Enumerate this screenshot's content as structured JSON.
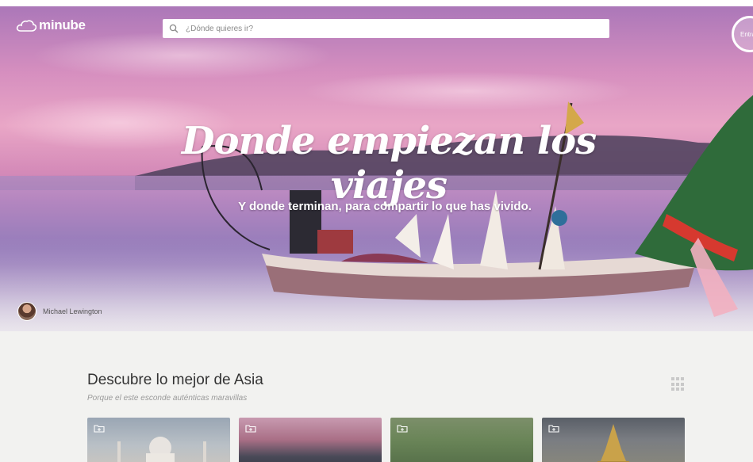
{
  "header": {
    "logo_text": "minube",
    "search_placeholder": "¿Dónde quieres ir?",
    "login_label": "Entrar"
  },
  "hero": {
    "title": "Donde empiezan los viajes",
    "subtitle": "Y donde terminan, para compartir lo que has vivido.",
    "photo_credit": "Michael Lewington"
  },
  "section": {
    "title": "Descubre lo mejor de Asia",
    "subtitle": "Porque el este esconde auténticas maravillas"
  },
  "cards": [
    {
      "icon": "folder-add-icon"
    },
    {
      "icon": "folder-add-icon"
    },
    {
      "icon": "folder-add-icon"
    },
    {
      "icon": "folder-add-icon"
    }
  ],
  "colors": {
    "page_bg": "#f2f2f0",
    "hero_pink": "#d68fbf",
    "text_dark": "#333333",
    "text_muted": "#9a9a9a"
  }
}
